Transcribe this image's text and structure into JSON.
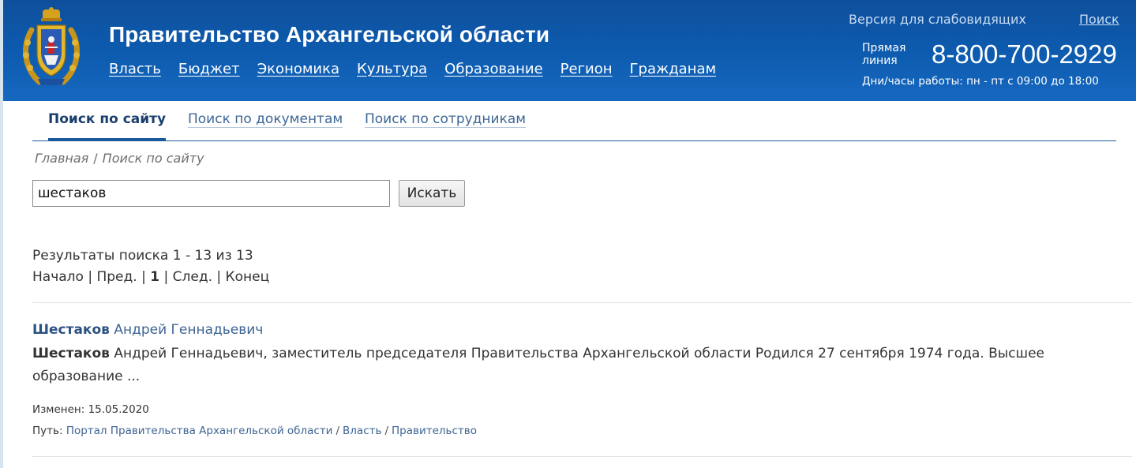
{
  "header": {
    "title": "Правительство Архангельской области",
    "nav": [
      "Власть",
      "Бюджет",
      "Экономика",
      "Культура",
      "Образование",
      "Регион",
      "Гражданам"
    ],
    "low_vision": "Версия для слабовидящих",
    "search": "Поиск",
    "hotline_label": "Прямая линия",
    "hotline_number": "8-800-700-2929",
    "work_hours": "Дни/часы работы: пн - пт с 09:00 до 18:00",
    "brand_color": "#0d5cb0"
  },
  "tabs": {
    "site": "Поиск по сайту",
    "docs": "Поиск по документам",
    "staff": "Поиск по сотрудникам"
  },
  "breadcrumb": {
    "home": "Главная",
    "sep": "/",
    "current": "Поиск по сайту"
  },
  "search": {
    "value": "шестаков",
    "button": "Искать"
  },
  "results": {
    "count_text": "Результаты поиска 1 - 13 из 13",
    "pager": {
      "first": "Начало",
      "prev": "Пред.",
      "current": "1",
      "next": "След.",
      "last": "Конец",
      "sep": "|"
    },
    "items": [
      {
        "title_bold": "Шестаков",
        "title_rest": " Андрей Геннадьевич",
        "snippet_bold": "Шестаков",
        "snippet_rest": " Андрей Геннадьевич, заместитель председателя Правительства Архангельской области Родился 27 сентября 1974 года. Высшее образование ...",
        "modified_label": "Изменен:",
        "modified_date": "15.05.2020",
        "path_label": "Путь:",
        "path": [
          "Портал Правительства Архангельской области",
          "Власть",
          "Правительство"
        ],
        "path_sep": "/"
      }
    ]
  }
}
